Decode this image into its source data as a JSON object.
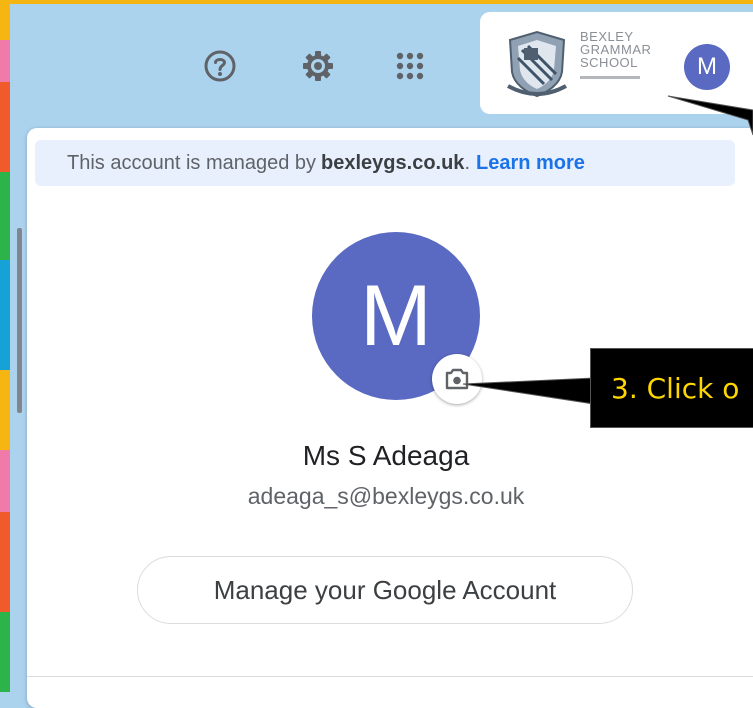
{
  "toolbar": {
    "help_icon": "help-icon",
    "settings_icon": "gear-icon",
    "apps_icon": "apps-grid-icon"
  },
  "brand": {
    "school_line1": "BEXLEY",
    "school_line2": "GRAMMAR",
    "school_line3": "SCHOOL",
    "avatar_initial": "M"
  },
  "account_panel": {
    "banner_prefix": "This account is managed by",
    "banner_domain": "bexleygs.co.uk",
    "banner_period": ".",
    "banner_link": "Learn more",
    "avatar_initial": "M",
    "camera_icon": "camera-icon",
    "user_name": "Ms S Adeaga",
    "user_email": "adeaga_s@bexleygs.co.uk",
    "manage_button": "Manage your Google Account"
  },
  "callout": {
    "text": "3. Click o"
  },
  "colors": {
    "background": "#acd3ee",
    "avatar": "#5a69c1",
    "link": "#1a73e8",
    "banner_bg": "#e8f0fd",
    "callout_text": "#ffd700",
    "top_border": "#f5b614"
  }
}
